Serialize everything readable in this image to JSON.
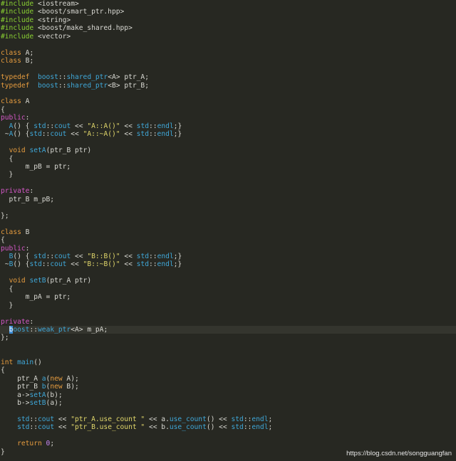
{
  "theme": {
    "background": "#272822",
    "current_line": "#34352e",
    "preprocessor": "#8ad133",
    "keyword": "#e59b3e",
    "access": "#d357c6",
    "namespace": "#3fa7d8",
    "string": "#e0d66a",
    "number": "#c886f5",
    "plain": "#d8d8d2"
  },
  "cursor_line": 40,
  "watermark": "https://blog.csdn.net/songguangfan",
  "lines": [
    [
      [
        "pp",
        "#include"
      ],
      [
        "plain",
        " <iostream>"
      ]
    ],
    [
      [
        "pp",
        "#include"
      ],
      [
        "plain",
        " <boost/smart_ptr.hpp>"
      ]
    ],
    [
      [
        "pp",
        "#include"
      ],
      [
        "plain",
        " <string>"
      ]
    ],
    [
      [
        "pp",
        "#include"
      ],
      [
        "plain",
        " <boost/make_shared.hpp>"
      ]
    ],
    [
      [
        "pp",
        "#include"
      ],
      [
        "plain",
        " <vector>"
      ]
    ],
    [],
    [
      [
        "kw",
        "class"
      ],
      [
        "plain",
        " A;"
      ]
    ],
    [
      [
        "kw",
        "class"
      ],
      [
        "plain",
        " B;"
      ]
    ],
    [],
    [
      [
        "kw",
        "typedef"
      ],
      [
        "plain",
        "  "
      ],
      [
        "ns",
        "boost"
      ],
      [
        "plain",
        "::"
      ],
      [
        "ns",
        "shared_ptr"
      ],
      [
        "plain",
        "<A> ptr_A;"
      ]
    ],
    [
      [
        "kw",
        "typedef"
      ],
      [
        "plain",
        "  "
      ],
      [
        "ns",
        "boost"
      ],
      [
        "plain",
        "::"
      ],
      [
        "ns",
        "shared_ptr"
      ],
      [
        "plain",
        "<B> ptr_B;"
      ]
    ],
    [],
    [
      [
        "kw",
        "class"
      ],
      [
        "plain",
        " A"
      ]
    ],
    [
      [
        "plain",
        "{"
      ]
    ],
    [
      [
        "access",
        "public"
      ],
      [
        "plain",
        ":"
      ]
    ],
    [
      [
        "plain",
        "  "
      ],
      [
        "fn",
        "A"
      ],
      [
        "plain",
        "() { "
      ],
      [
        "ns",
        "std"
      ],
      [
        "plain",
        "::"
      ],
      [
        "ns",
        "cout"
      ],
      [
        "plain",
        " << "
      ],
      [
        "str",
        "\"A::A()\""
      ],
      [
        "plain",
        " << "
      ],
      [
        "ns",
        "std"
      ],
      [
        "plain",
        "::"
      ],
      [
        "ns",
        "endl"
      ],
      [
        "plain",
        ";}"
      ]
    ],
    [
      [
        "plain",
        " ~"
      ],
      [
        "fn",
        "A"
      ],
      [
        "plain",
        "() {"
      ],
      [
        "ns",
        "std"
      ],
      [
        "plain",
        "::"
      ],
      [
        "ns",
        "cout"
      ],
      [
        "plain",
        " << "
      ],
      [
        "str",
        "\"A::~A()\""
      ],
      [
        "plain",
        " << "
      ],
      [
        "ns",
        "std"
      ],
      [
        "plain",
        "::"
      ],
      [
        "ns",
        "endl"
      ],
      [
        "plain",
        ";}"
      ]
    ],
    [],
    [
      [
        "plain",
        "  "
      ],
      [
        "kw",
        "void"
      ],
      [
        "plain",
        " "
      ],
      [
        "fn",
        "setA"
      ],
      [
        "plain",
        "(ptr_B ptr)"
      ]
    ],
    [
      [
        "plain",
        "  {"
      ]
    ],
    [
      [
        "plain",
        "      m_pB = ptr;"
      ]
    ],
    [
      [
        "plain",
        "  }"
      ]
    ],
    [],
    [
      [
        "access",
        "private"
      ],
      [
        "plain",
        ":"
      ]
    ],
    [
      [
        "plain",
        "  ptr_B m_pB;"
      ]
    ],
    [],
    [
      [
        "plain",
        "};"
      ]
    ],
    [],
    [
      [
        "kw",
        "class"
      ],
      [
        "plain",
        " B"
      ]
    ],
    [
      [
        "plain",
        "{"
      ]
    ],
    [
      [
        "access",
        "public"
      ],
      [
        "plain",
        ":"
      ]
    ],
    [
      [
        "plain",
        "  "
      ],
      [
        "fn",
        "B"
      ],
      [
        "plain",
        "() { "
      ],
      [
        "ns",
        "std"
      ],
      [
        "plain",
        "::"
      ],
      [
        "ns",
        "cout"
      ],
      [
        "plain",
        " << "
      ],
      [
        "str",
        "\"B::B()\""
      ],
      [
        "plain",
        " << "
      ],
      [
        "ns",
        "std"
      ],
      [
        "plain",
        "::"
      ],
      [
        "ns",
        "endl"
      ],
      [
        "plain",
        ";}"
      ]
    ],
    [
      [
        "plain",
        " ~"
      ],
      [
        "fn",
        "B"
      ],
      [
        "plain",
        "() {"
      ],
      [
        "ns",
        "std"
      ],
      [
        "plain",
        "::"
      ],
      [
        "ns",
        "cout"
      ],
      [
        "plain",
        " << "
      ],
      [
        "str",
        "\"B::~B()\""
      ],
      [
        "plain",
        " << "
      ],
      [
        "ns",
        "std"
      ],
      [
        "plain",
        "::"
      ],
      [
        "ns",
        "endl"
      ],
      [
        "plain",
        ";}"
      ]
    ],
    [],
    [
      [
        "plain",
        "  "
      ],
      [
        "kw",
        "void"
      ],
      [
        "plain",
        " "
      ],
      [
        "fn",
        "setB"
      ],
      [
        "plain",
        "(ptr_A ptr)"
      ]
    ],
    [
      [
        "plain",
        "  {"
      ]
    ],
    [
      [
        "plain",
        "      m_pA = ptr;"
      ]
    ],
    [
      [
        "plain",
        "  }"
      ]
    ],
    [],
    [
      [
        "access",
        "private"
      ],
      [
        "plain",
        ":"
      ]
    ],
    [
      [
        "plain",
        "  "
      ],
      [
        "cursor",
        "b"
      ],
      [
        "ns",
        "oost"
      ],
      [
        "plain",
        "::"
      ],
      [
        "ns",
        "weak_ptr"
      ],
      [
        "plain",
        "<A> m_pA;"
      ]
    ],
    [
      [
        "plain",
        "};"
      ]
    ],
    [],
    [],
    [
      [
        "kw",
        "int"
      ],
      [
        "plain",
        " "
      ],
      [
        "fn",
        "main"
      ],
      [
        "plain",
        "()"
      ]
    ],
    [
      [
        "plain",
        "{"
      ]
    ],
    [
      [
        "plain",
        "    ptr_A "
      ],
      [
        "fn",
        "a"
      ],
      [
        "plain",
        "("
      ],
      [
        "kw",
        "new"
      ],
      [
        "plain",
        " A);"
      ]
    ],
    [
      [
        "plain",
        "    ptr_B "
      ],
      [
        "fn",
        "b"
      ],
      [
        "plain",
        "("
      ],
      [
        "kw",
        "new"
      ],
      [
        "plain",
        " B);"
      ]
    ],
    [
      [
        "plain",
        "    a->"
      ],
      [
        "fn",
        "setA"
      ],
      [
        "plain",
        "(b);"
      ]
    ],
    [
      [
        "plain",
        "    b->"
      ],
      [
        "fn",
        "setB"
      ],
      [
        "plain",
        "(a);"
      ]
    ],
    [],
    [
      [
        "plain",
        "    "
      ],
      [
        "ns",
        "std"
      ],
      [
        "plain",
        "::"
      ],
      [
        "ns",
        "cout"
      ],
      [
        "plain",
        " << "
      ],
      [
        "str",
        "\"ptr_A.use_count \""
      ],
      [
        "plain",
        " << a."
      ],
      [
        "fn",
        "use_count"
      ],
      [
        "plain",
        "() << "
      ],
      [
        "ns",
        "std"
      ],
      [
        "plain",
        "::"
      ],
      [
        "ns",
        "endl"
      ],
      [
        "plain",
        ";"
      ]
    ],
    [
      [
        "plain",
        "    "
      ],
      [
        "ns",
        "std"
      ],
      [
        "plain",
        "::"
      ],
      [
        "ns",
        "cout"
      ],
      [
        "plain",
        " << "
      ],
      [
        "str",
        "\"ptr_B.use_count \""
      ],
      [
        "plain",
        " << b."
      ],
      [
        "fn",
        "use_count"
      ],
      [
        "plain",
        "() << "
      ],
      [
        "ns",
        "std"
      ],
      [
        "plain",
        "::"
      ],
      [
        "ns",
        "endl"
      ],
      [
        "plain",
        ";"
      ]
    ],
    [],
    [
      [
        "plain",
        "    "
      ],
      [
        "kw",
        "return"
      ],
      [
        "plain",
        " "
      ],
      [
        "num",
        "0"
      ],
      [
        "plain",
        ";"
      ]
    ],
    [
      [
        "plain",
        "}"
      ]
    ]
  ]
}
